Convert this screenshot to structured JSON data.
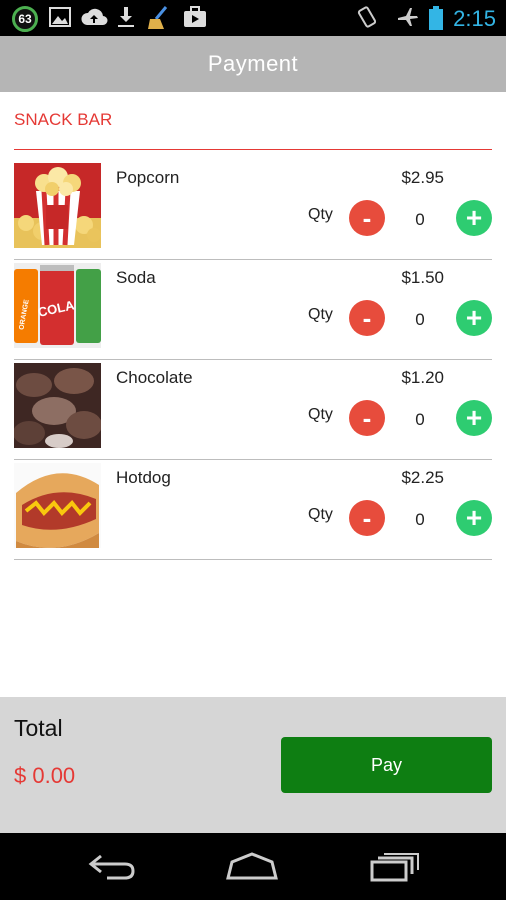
{
  "status_bar": {
    "notification_count": "63",
    "time": "2:15",
    "icons": [
      "image-icon",
      "cloud-upload-icon",
      "download-icon",
      "broom-icon",
      "briefcase-icon",
      "vibrate-icon",
      "airplane-icon",
      "battery-icon"
    ]
  },
  "header": {
    "title": "Payment"
  },
  "section": {
    "title": "SNACK BAR"
  },
  "items": [
    {
      "name": "Popcorn",
      "price": "$2.95",
      "qty_label": "Qty",
      "qty": "0",
      "minus": "-",
      "plus": "+"
    },
    {
      "name": "Soda",
      "price": "$1.50",
      "qty_label": "Qty",
      "qty": "0",
      "minus": "-",
      "plus": "+"
    },
    {
      "name": "Chocolate",
      "price": "$1.20",
      "qty_label": "Qty",
      "qty": "0",
      "minus": "-",
      "plus": "+"
    },
    {
      "name": "Hotdog",
      "price": "$2.25",
      "qty_label": "Qty",
      "qty": "0",
      "minus": "-",
      "plus": "+"
    }
  ],
  "footer": {
    "total_label": "Total",
    "total_value": "$ 0.00",
    "pay_label": "Pay"
  },
  "colors": {
    "accent_red": "#e53935",
    "plus_green": "#2ecc71",
    "pay_green": "#0e7e12",
    "status_time_blue": "#33b5e5"
  },
  "nav": {
    "icons": [
      "back-icon",
      "home-icon",
      "recent-apps-icon"
    ]
  }
}
